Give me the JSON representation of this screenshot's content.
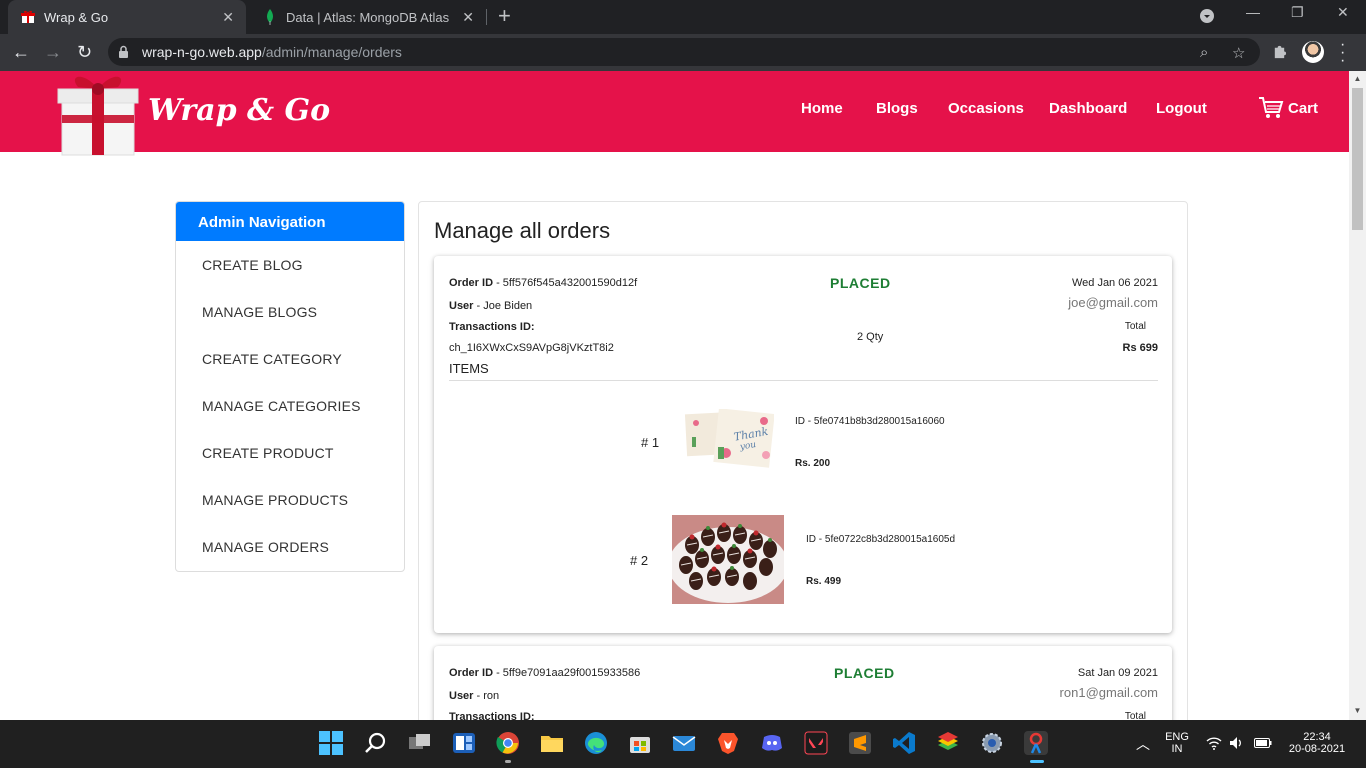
{
  "browser": {
    "tabs": [
      {
        "title": "Wrap & Go",
        "active": true
      },
      {
        "title": "Data | Atlas: MongoDB Atlas",
        "active": false
      }
    ],
    "url_host": "wrap-n-go.web.app",
    "url_path": "/admin/manage/orders"
  },
  "site": {
    "brand": "Wrap & Go",
    "nav": [
      "Home",
      "Blogs",
      "Occasions",
      "Dashboard",
      "Logout"
    ],
    "cart_label": "Cart",
    "accent_color": "#e5124a"
  },
  "sidebar": {
    "heading": "Admin Navigation",
    "items": [
      "CREATE BLOG",
      "MANAGE BLOGS",
      "CREATE CATEGORY",
      "MANAGE CATEGORIES",
      "CREATE PRODUCT",
      "MANAGE PRODUCTS",
      "MANAGE ORDERS"
    ]
  },
  "main": {
    "title": "Manage all orders",
    "orders": [
      {
        "id_label": "Order ID",
        "id": "5ff576f545a432001590d12f",
        "user_label": "User",
        "user": "Joe Biden",
        "txn_label": "Transactions ID:",
        "txn": "ch_1I6XWxCxS9AVpG8jVKztT8i2",
        "status": "PLACED",
        "qty": "2 Qty",
        "date": "Wed Jan 06 2021",
        "email": "joe@gmail.com",
        "total_label": "Total",
        "total": "Rs 699",
        "items_label": "ITEMS",
        "items": [
          {
            "num": "# 1",
            "id": "5fe0741b8b3d280015a16060",
            "price": "Rs. 200",
            "image": "thank-you-card"
          },
          {
            "num": "# 2",
            "id": "5fe0722c8b3d280015a1605d",
            "price": "Rs. 499",
            "image": "chocolate-strawberries"
          }
        ]
      },
      {
        "id_label": "Order ID",
        "id": "5ff9e7091aa29f0015933586",
        "user_label": "User",
        "user": "ron",
        "txn_label": "Transactions ID:",
        "status": "PLACED",
        "date": "Sat Jan 09 2021",
        "email": "ron1@gmail.com",
        "total_label": "Total"
      }
    ]
  },
  "taskbar": {
    "lang": "ENG",
    "region": "IN",
    "time": "22:34",
    "date": "20-08-2021"
  }
}
